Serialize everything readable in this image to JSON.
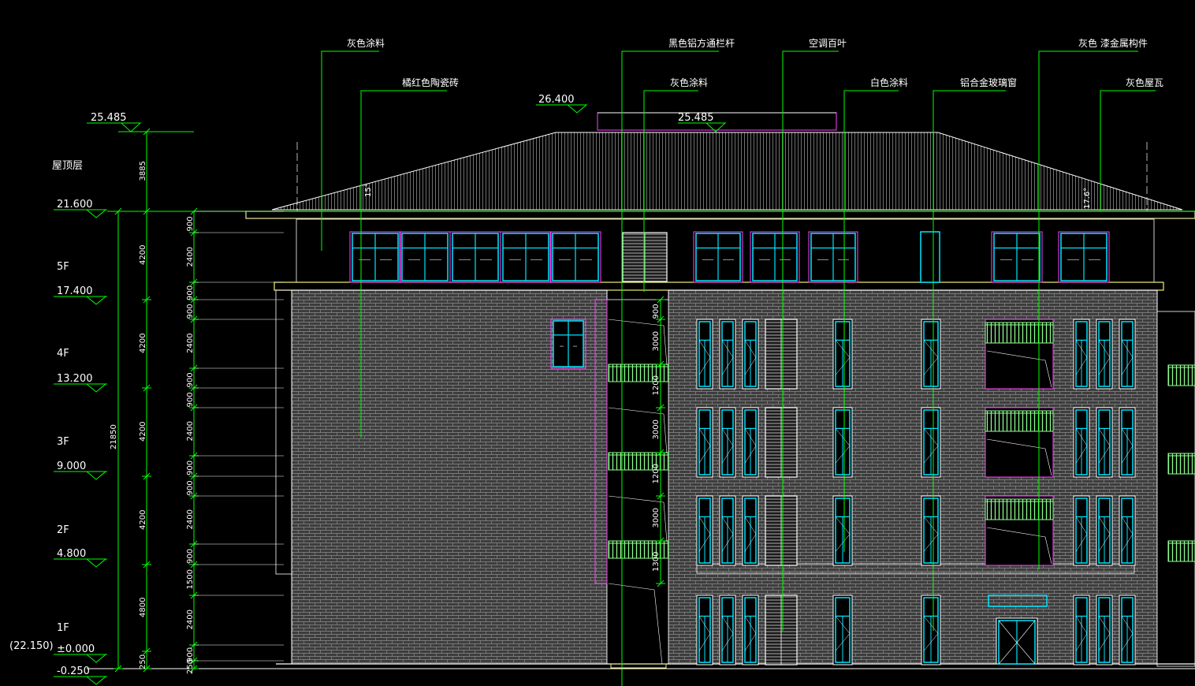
{
  "annotations": {
    "gray_coating_1": "灰色涂料",
    "orange_red_tile": "橘红色陶瓷砖",
    "black_aluminum_grille": "黑色铝方通栏杆",
    "gray_coating_2": "灰色涂料",
    "ac_louver": "空调百叶",
    "white_coating": "白色涂料",
    "aluminum_glass_window": "铝合金玻璃窗",
    "gray_painted_metal": "灰色  漆金属构件",
    "gray_roof_tile": "灰色屋瓦"
  },
  "elevations": {
    "top_left": "25.485",
    "top_center": "25.485",
    "parapet": "26.400"
  },
  "roof_slopes": {
    "left": "15°",
    "right": "17.6°"
  },
  "levels": [
    {
      "name": "屋顶层",
      "elev": "21.600"
    },
    {
      "name": "5F",
      "elev": "17.400"
    },
    {
      "name": "4F",
      "elev": "13.200"
    },
    {
      "name": "3F",
      "elev": "9.000"
    },
    {
      "name": "2F",
      "elev": "4.800"
    },
    {
      "name": "1F",
      "elev": "±0.000"
    },
    {
      "name": "",
      "elev": "-0.250"
    }
  ],
  "ref_elevation": "(22.150)",
  "dims_total": "21850",
  "dims_left": [
    "3885",
    "4200",
    "4200",
    "4200",
    "4200",
    "4800",
    "250"
  ],
  "dims_right": [
    "900",
    "2400",
    "900",
    "900",
    "2400",
    "900",
    "900",
    "2400",
    "900",
    "900",
    "2400",
    "900",
    "1500",
    "2400",
    "900",
    "250"
  ],
  "dims_balcony": [
    "900",
    "3000",
    "1200",
    "3000",
    "1200",
    "3000",
    "1300"
  ]
}
